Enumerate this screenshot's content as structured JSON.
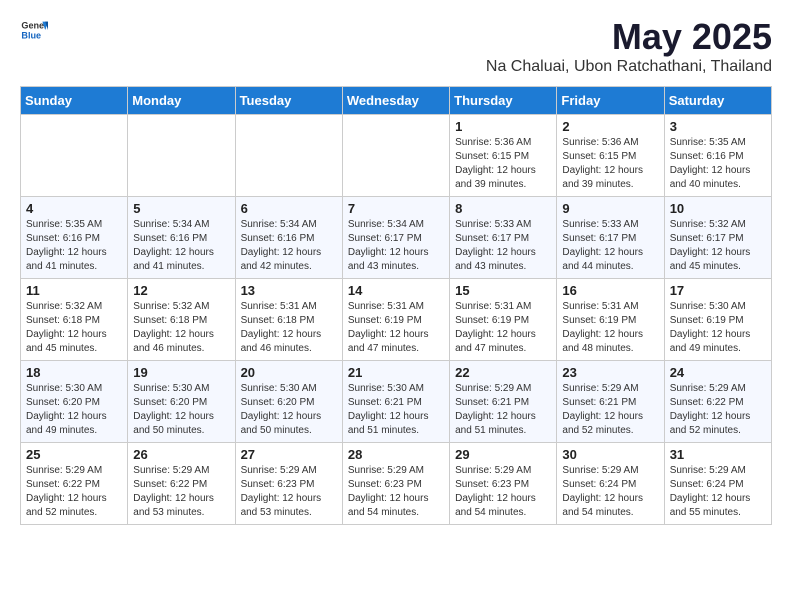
{
  "header": {
    "logo_general": "General",
    "logo_blue": "Blue",
    "title": "May 2025",
    "location": "Na Chaluai, Ubon Ratchathani, Thailand"
  },
  "calendar": {
    "days_of_week": [
      "Sunday",
      "Monday",
      "Tuesday",
      "Wednesday",
      "Thursday",
      "Friday",
      "Saturday"
    ],
    "weeks": [
      [
        {
          "day": "",
          "info": ""
        },
        {
          "day": "",
          "info": ""
        },
        {
          "day": "",
          "info": ""
        },
        {
          "day": "",
          "info": ""
        },
        {
          "day": "1",
          "info": "Sunrise: 5:36 AM\nSunset: 6:15 PM\nDaylight: 12 hours\nand 39 minutes."
        },
        {
          "day": "2",
          "info": "Sunrise: 5:36 AM\nSunset: 6:15 PM\nDaylight: 12 hours\nand 39 minutes."
        },
        {
          "day": "3",
          "info": "Sunrise: 5:35 AM\nSunset: 6:16 PM\nDaylight: 12 hours\nand 40 minutes."
        }
      ],
      [
        {
          "day": "4",
          "info": "Sunrise: 5:35 AM\nSunset: 6:16 PM\nDaylight: 12 hours\nand 41 minutes."
        },
        {
          "day": "5",
          "info": "Sunrise: 5:34 AM\nSunset: 6:16 PM\nDaylight: 12 hours\nand 41 minutes."
        },
        {
          "day": "6",
          "info": "Sunrise: 5:34 AM\nSunset: 6:16 PM\nDaylight: 12 hours\nand 42 minutes."
        },
        {
          "day": "7",
          "info": "Sunrise: 5:34 AM\nSunset: 6:17 PM\nDaylight: 12 hours\nand 43 minutes."
        },
        {
          "day": "8",
          "info": "Sunrise: 5:33 AM\nSunset: 6:17 PM\nDaylight: 12 hours\nand 43 minutes."
        },
        {
          "day": "9",
          "info": "Sunrise: 5:33 AM\nSunset: 6:17 PM\nDaylight: 12 hours\nand 44 minutes."
        },
        {
          "day": "10",
          "info": "Sunrise: 5:32 AM\nSunset: 6:17 PM\nDaylight: 12 hours\nand 45 minutes."
        }
      ],
      [
        {
          "day": "11",
          "info": "Sunrise: 5:32 AM\nSunset: 6:18 PM\nDaylight: 12 hours\nand 45 minutes."
        },
        {
          "day": "12",
          "info": "Sunrise: 5:32 AM\nSunset: 6:18 PM\nDaylight: 12 hours\nand 46 minutes."
        },
        {
          "day": "13",
          "info": "Sunrise: 5:31 AM\nSunset: 6:18 PM\nDaylight: 12 hours\nand 46 minutes."
        },
        {
          "day": "14",
          "info": "Sunrise: 5:31 AM\nSunset: 6:19 PM\nDaylight: 12 hours\nand 47 minutes."
        },
        {
          "day": "15",
          "info": "Sunrise: 5:31 AM\nSunset: 6:19 PM\nDaylight: 12 hours\nand 47 minutes."
        },
        {
          "day": "16",
          "info": "Sunrise: 5:31 AM\nSunset: 6:19 PM\nDaylight: 12 hours\nand 48 minutes."
        },
        {
          "day": "17",
          "info": "Sunrise: 5:30 AM\nSunset: 6:19 PM\nDaylight: 12 hours\nand 49 minutes."
        }
      ],
      [
        {
          "day": "18",
          "info": "Sunrise: 5:30 AM\nSunset: 6:20 PM\nDaylight: 12 hours\nand 49 minutes."
        },
        {
          "day": "19",
          "info": "Sunrise: 5:30 AM\nSunset: 6:20 PM\nDaylight: 12 hours\nand 50 minutes."
        },
        {
          "day": "20",
          "info": "Sunrise: 5:30 AM\nSunset: 6:20 PM\nDaylight: 12 hours\nand 50 minutes."
        },
        {
          "day": "21",
          "info": "Sunrise: 5:30 AM\nSunset: 6:21 PM\nDaylight: 12 hours\nand 51 minutes."
        },
        {
          "day": "22",
          "info": "Sunrise: 5:29 AM\nSunset: 6:21 PM\nDaylight: 12 hours\nand 51 minutes."
        },
        {
          "day": "23",
          "info": "Sunrise: 5:29 AM\nSunset: 6:21 PM\nDaylight: 12 hours\nand 52 minutes."
        },
        {
          "day": "24",
          "info": "Sunrise: 5:29 AM\nSunset: 6:22 PM\nDaylight: 12 hours\nand 52 minutes."
        }
      ],
      [
        {
          "day": "25",
          "info": "Sunrise: 5:29 AM\nSunset: 6:22 PM\nDaylight: 12 hours\nand 52 minutes."
        },
        {
          "day": "26",
          "info": "Sunrise: 5:29 AM\nSunset: 6:22 PM\nDaylight: 12 hours\nand 53 minutes."
        },
        {
          "day": "27",
          "info": "Sunrise: 5:29 AM\nSunset: 6:23 PM\nDaylight: 12 hours\nand 53 minutes."
        },
        {
          "day": "28",
          "info": "Sunrise: 5:29 AM\nSunset: 6:23 PM\nDaylight: 12 hours\nand 54 minutes."
        },
        {
          "day": "29",
          "info": "Sunrise: 5:29 AM\nSunset: 6:23 PM\nDaylight: 12 hours\nand 54 minutes."
        },
        {
          "day": "30",
          "info": "Sunrise: 5:29 AM\nSunset: 6:24 PM\nDaylight: 12 hours\nand 54 minutes."
        },
        {
          "day": "31",
          "info": "Sunrise: 5:29 AM\nSunset: 6:24 PM\nDaylight: 12 hours\nand 55 minutes."
        }
      ]
    ]
  }
}
